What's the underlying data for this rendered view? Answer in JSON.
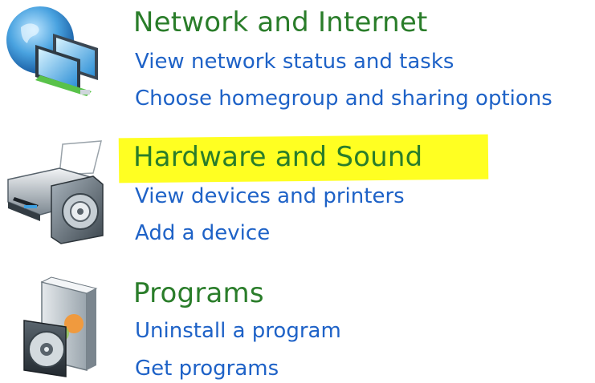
{
  "categories": [
    {
      "title": "Network and Internet",
      "links": [
        "View network status and tasks",
        "Choose homegroup and sharing options"
      ]
    },
    {
      "title": "Hardware and Sound",
      "links": [
        "View devices and printers",
        "Add a device"
      ]
    },
    {
      "title": "Programs",
      "links": [
        "Uninstall a program",
        "Get programs"
      ]
    }
  ],
  "colors": {
    "title_green": "#2a7d2a",
    "link_blue": "#1e62c7",
    "highlight_yellow": "#ffff22"
  },
  "icons": {
    "network": "network-globe-monitors-icon",
    "hardware": "printer-speaker-icon",
    "programs": "programs-disc-box-icon"
  }
}
